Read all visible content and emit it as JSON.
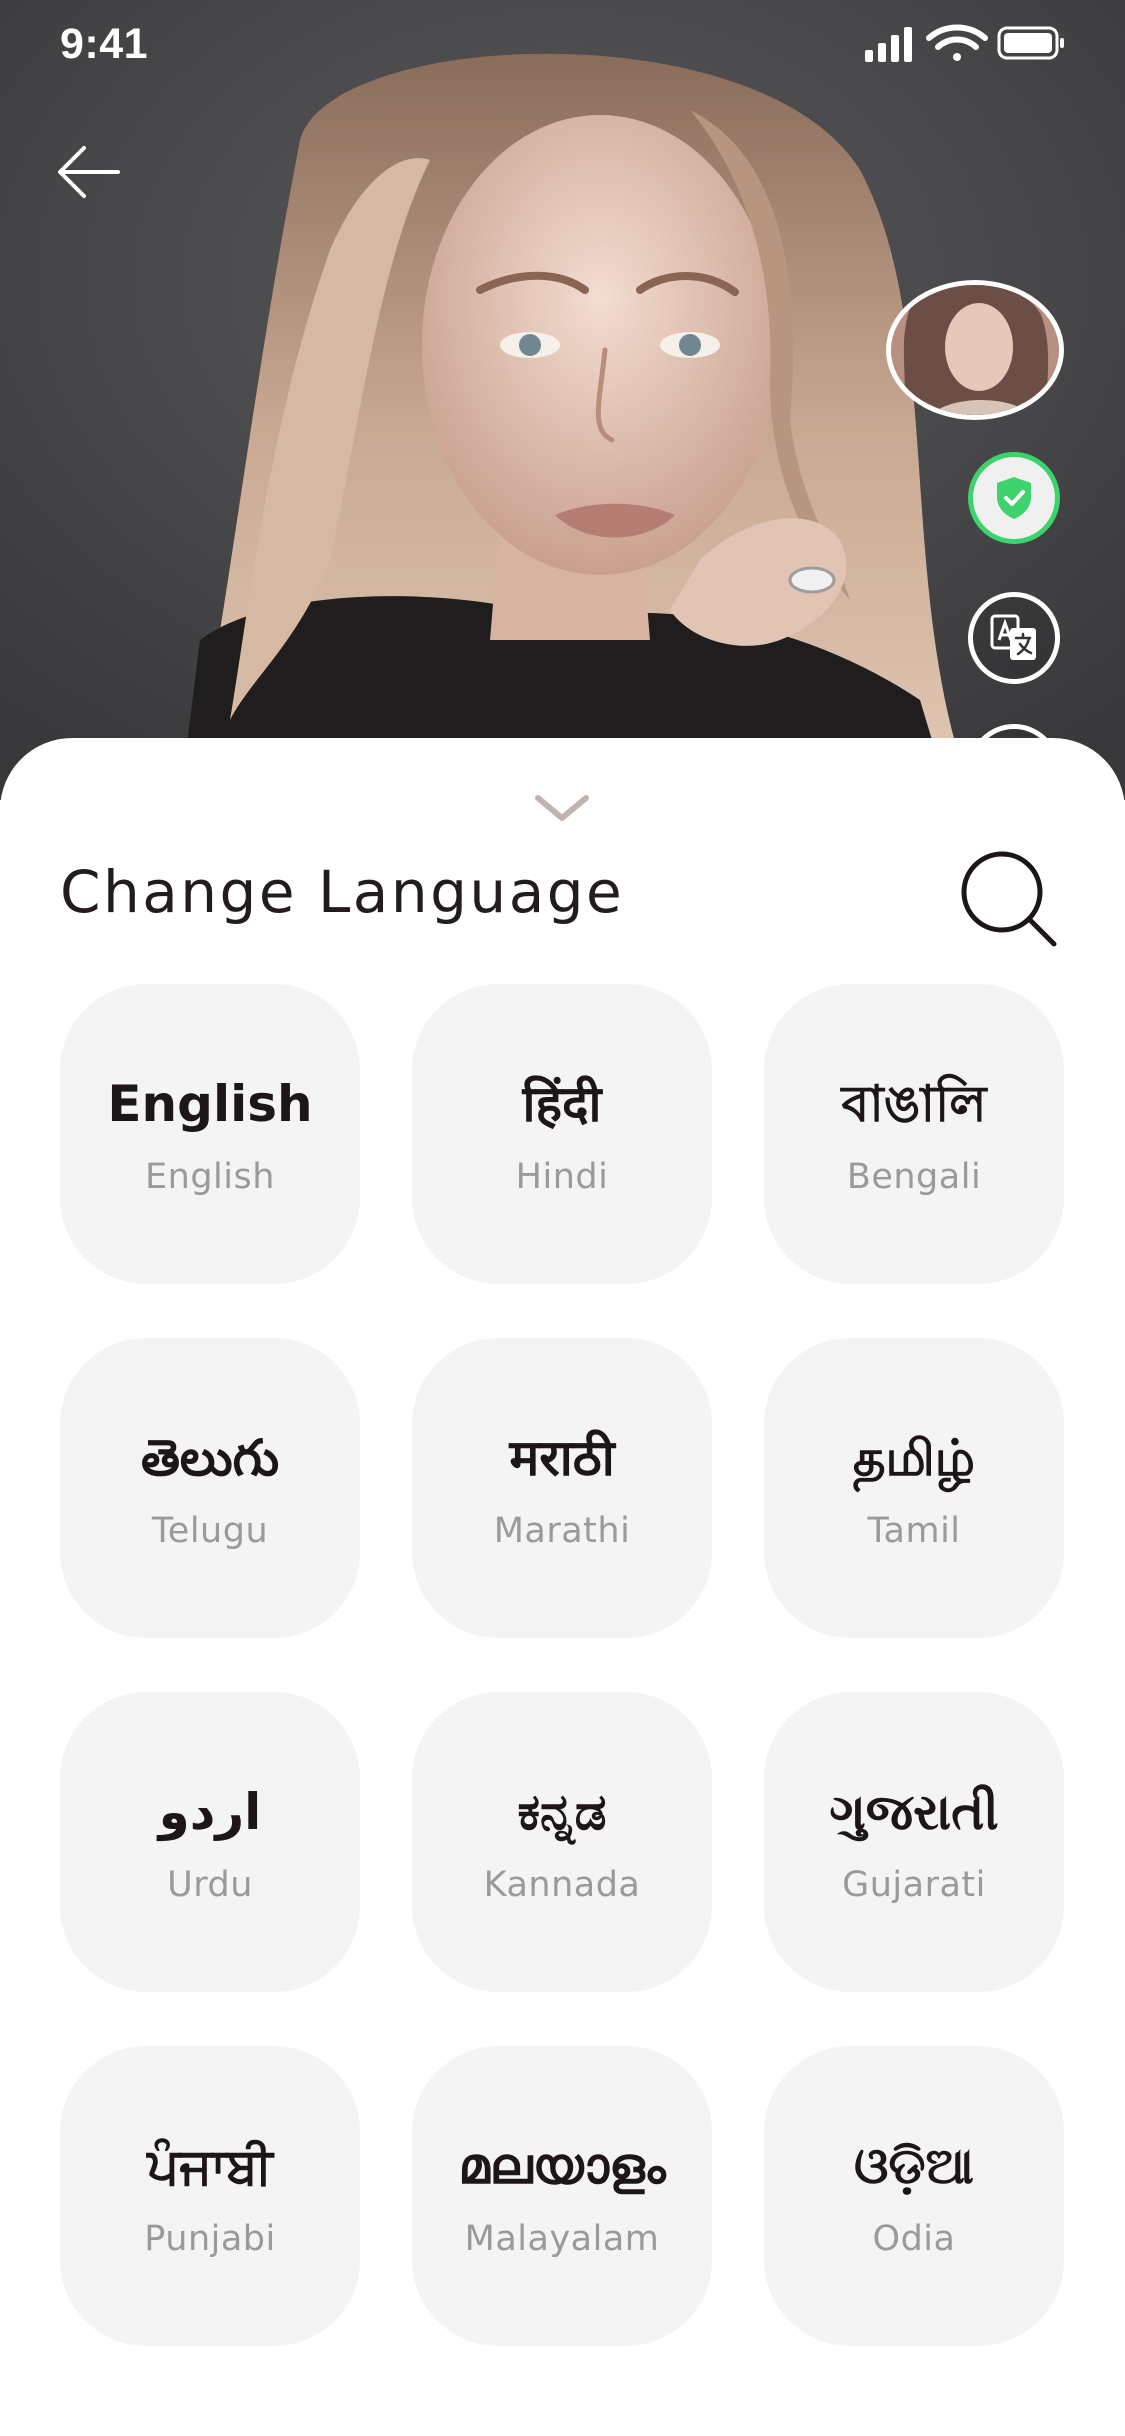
{
  "status_bar": {
    "time": "9:41"
  },
  "sheet": {
    "title": "Change Language"
  },
  "languages": [
    {
      "native": "English",
      "english": "English"
    },
    {
      "native": "हिंदी",
      "english": "Hindi"
    },
    {
      "native": "বাঙালি",
      "english": "Bengali"
    },
    {
      "native": "తెలుగు",
      "english": "Telugu"
    },
    {
      "native": "मराठी",
      "english": "Marathi"
    },
    {
      "native": "தமிழ்",
      "english": "Tamil"
    },
    {
      "native": "اردو",
      "english": "Urdu"
    },
    {
      "native": "ಕನ್ನಡ",
      "english": "Kannada"
    },
    {
      "native": "ગુજરાતી",
      "english": "Gujarati"
    },
    {
      "native": "ਪੰਜਾਬੀ",
      "english": "Punjabi"
    },
    {
      "native": "മലയാളം",
      "english": "Malayalam"
    },
    {
      "native": "ଓଡ଼ିଆ",
      "english": "Odia"
    }
  ],
  "colors": {
    "sheet_background": "#ffffff",
    "card_background": "#f5f4f4",
    "title_text": "#221c1c",
    "native_text": "#1d1616",
    "secondary_text": "#9a9a9a",
    "shield_accent": "#3ed26c"
  },
  "icons": {
    "back": "arrow-left-icon",
    "verified": "shield-check-icon",
    "translate": "translate-icon",
    "collapse": "chevron-down-icon",
    "search": "search-icon"
  }
}
